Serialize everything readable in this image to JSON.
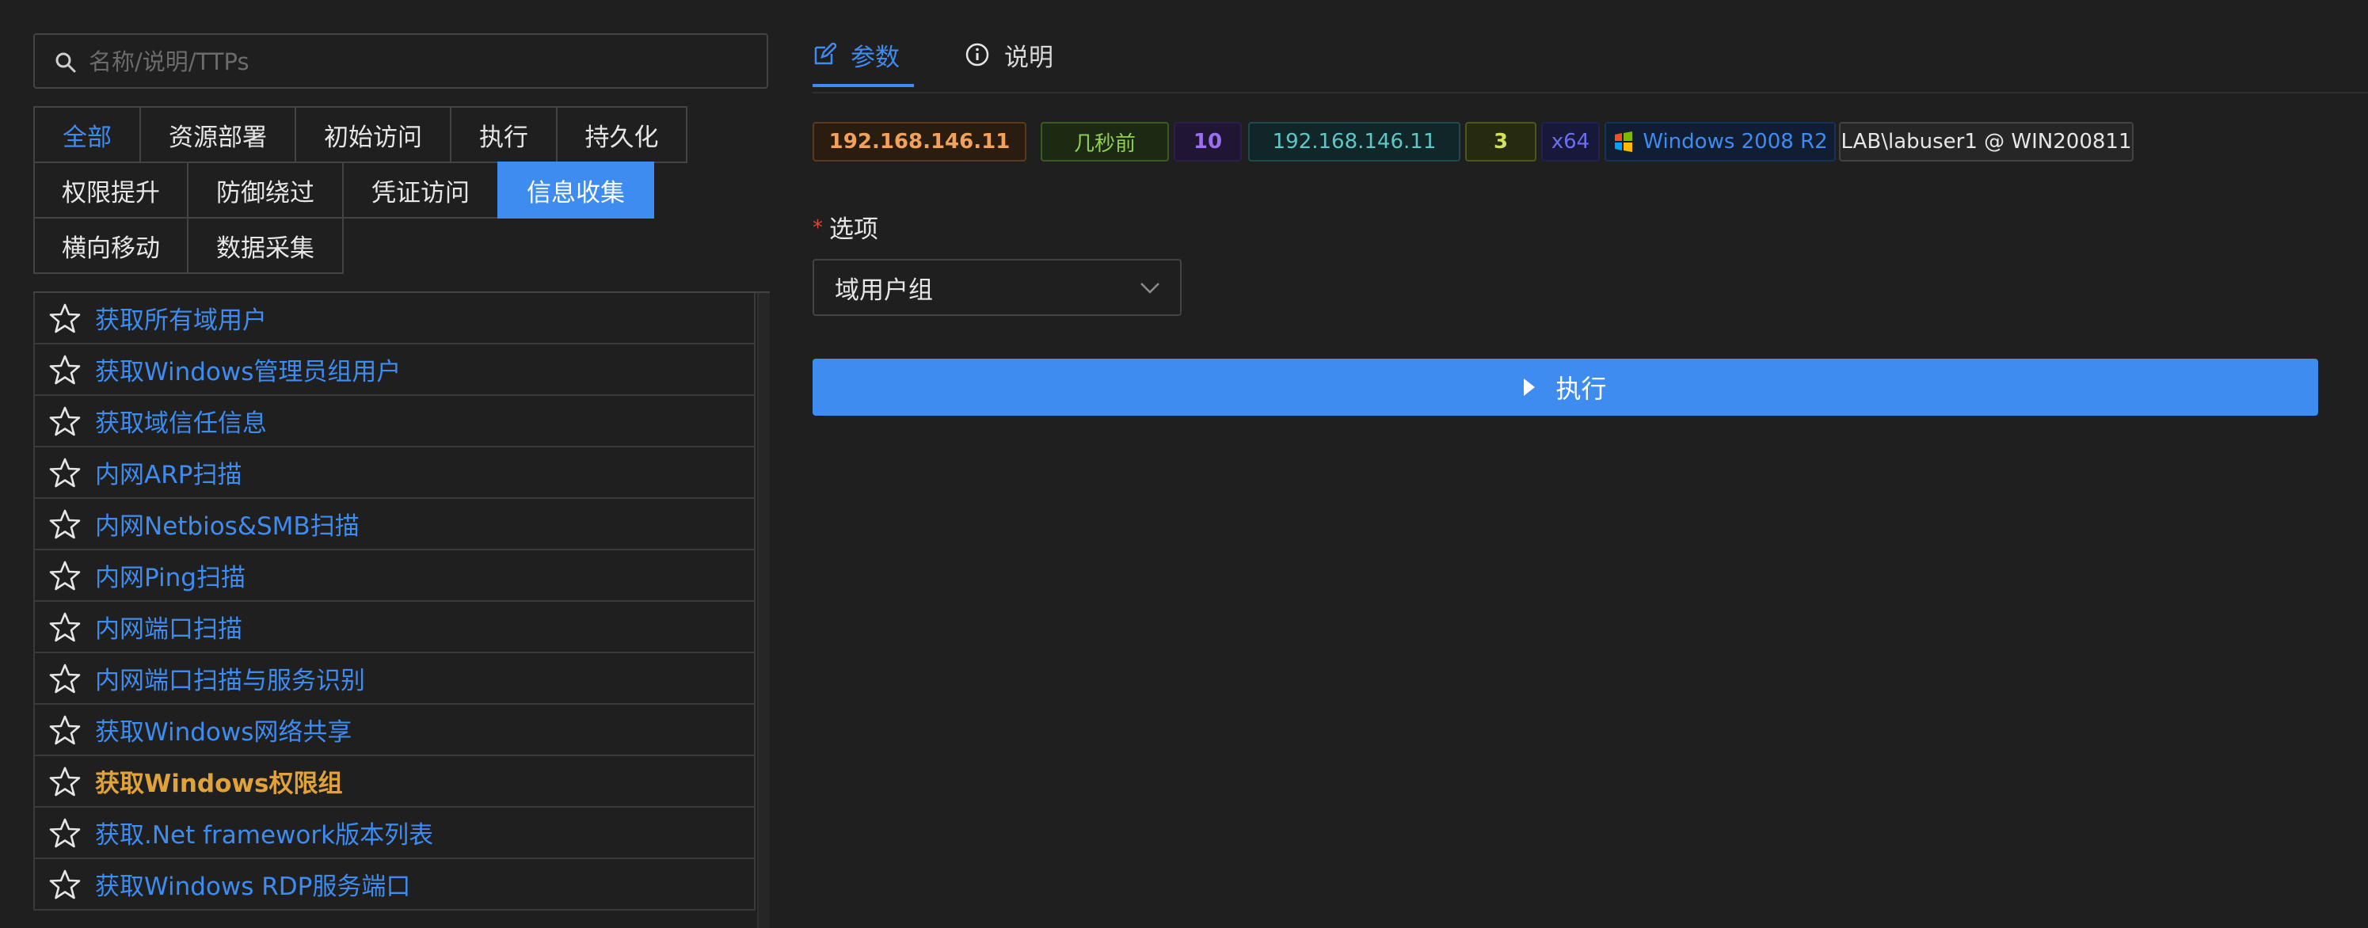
{
  "search": {
    "placeholder": "名称/说明/TTPs"
  },
  "categories": [
    "全部",
    "资源部署",
    "初始访问",
    "执行",
    "持久化",
    "权限提升",
    "防御绕过",
    "凭证访问",
    "信息收集",
    "横向移动",
    "数据采集"
  ],
  "active_category": "信息收集",
  "modules": [
    "获取所有域用户",
    "获取Windows管理员组用户",
    "获取域信任信息",
    "内网ARP扫描",
    "内网Netbios&SMB扫描",
    "内网Ping扫描",
    "内网端口扫描",
    "内网端口扫描与服务识别",
    "获取Windows网络共享",
    "获取Windows权限组",
    "获取.Net framework版本列表",
    "获取Windows RDP服务端口"
  ],
  "tabs": {
    "params": "参数",
    "description": "说明"
  },
  "session": {
    "external_ip": "192.168.146.11",
    "last_seen": "几秒前",
    "pid": "10",
    "internal_ip": "192.168.146.11",
    "integrity": "3",
    "arch": "x64",
    "os": "Windows 2008 R2",
    "user_host": "LAB\\labuser1 @ WIN200811"
  },
  "form": {
    "option_label": "选项",
    "required_mark": "*",
    "option_value": "域用户组"
  },
  "run_button": "执行",
  "colors": {
    "accent": "#3f8cf0",
    "highlight_item": "#e0a33a",
    "background": "#1f1f1f"
  }
}
